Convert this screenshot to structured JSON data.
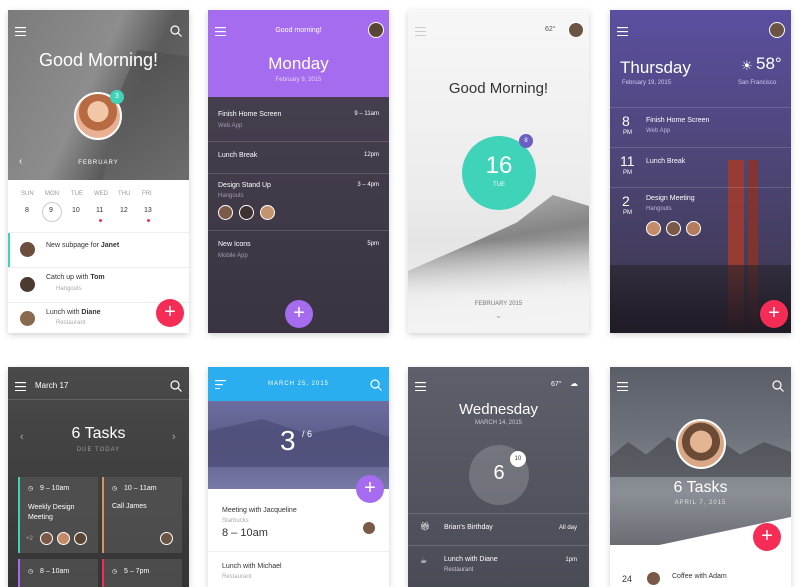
{
  "colors": {
    "accent_pink": "#f52d56",
    "accent_purple": "#a66cf0",
    "accent_teal": "#3fd3b9",
    "accent_blue": "#2aaef0"
  },
  "c1": {
    "greeting": "Good Morning!",
    "badge": "3",
    "month": "FEBRUARY",
    "days": [
      {
        "name": "SUN",
        "num": "8"
      },
      {
        "name": "MON",
        "num": "9"
      },
      {
        "name": "TUE",
        "num": "10"
      },
      {
        "name": "WED",
        "num": "11"
      },
      {
        "name": "THU",
        "num": "12"
      },
      {
        "name": "FRI",
        "num": "13"
      }
    ],
    "items": [
      {
        "prefix": "New subpage for ",
        "bold": "Janet",
        "meta": ""
      },
      {
        "prefix": "Catch up with ",
        "bold": "Tom",
        "meta": "Hangouts"
      },
      {
        "prefix": "Lunch with ",
        "bold": "Diane",
        "meta": "Restaurant"
      }
    ]
  },
  "c2": {
    "greeting": "Good morning!",
    "day": "Monday",
    "date": "February 9, 2015",
    "events": [
      {
        "title": "Finish Home Screen",
        "sub": "Web App",
        "time": "9 – 11am"
      },
      {
        "title": "Lunch Break",
        "sub": "",
        "time": "12pm"
      },
      {
        "title": "Design Stand Up",
        "sub": "Hangouts",
        "time": "3 – 4pm"
      },
      {
        "title": "New Icons",
        "sub": "Mobile App",
        "time": "5pm"
      }
    ]
  },
  "c3": {
    "temp": "62°",
    "greeting": "Good Morning!",
    "number": "16",
    "weekday": "TUE",
    "badge": "8",
    "month": "FEBRUARY 2015"
  },
  "c4": {
    "day": "Thursday",
    "date": "February 19, 2015",
    "temp": "58°",
    "city": "San Francisco",
    "events": [
      {
        "num": "8",
        "label": "PM",
        "title": "Finish Home Screen",
        "sub": "Web App"
      },
      {
        "num": "11",
        "label": "PM",
        "title": "Lunch Break",
        "sub": ""
      },
      {
        "num": "2",
        "label": "PM",
        "title": "Design Meeting",
        "sub": "Hangouts"
      }
    ]
  },
  "c5": {
    "date": "March 17",
    "tasks": "6 Tasks",
    "due": "DUE TODAY",
    "tiles": [
      {
        "time": "9 – 10am",
        "title": "Weekly Design Meeting",
        "extra": "+2"
      },
      {
        "time": "10 – 11am",
        "title": "Call James",
        "extra": ""
      },
      {
        "time": "8 – 10am",
        "title": "",
        "extra": ""
      },
      {
        "time": "5 – 7pm",
        "title": "",
        "extra": ""
      }
    ]
  },
  "c6": {
    "date": "MARCH 25, 2015",
    "progress_num": "3",
    "progress_den": "/ 6",
    "items": [
      {
        "title": "Meeting with Jacqueline",
        "sub": "Starbucks",
        "time": "8 – 10am"
      },
      {
        "title": "Lunch with Michael",
        "sub": "Restaurant",
        "time": ""
      }
    ]
  },
  "c7": {
    "temp": "67°",
    "day": "Wednesday",
    "date": "MARCH 14, 2015",
    "number": "6",
    "badge": "10",
    "items": [
      {
        "title": "Brian's Birthday",
        "sub": "",
        "right": "All day"
      },
      {
        "title": "Lunch with Diane",
        "sub": "Restaurant",
        "right": "1pm"
      }
    ]
  },
  "c8": {
    "tasks": "6 Tasks",
    "date": "APRIL 7, 2015",
    "row_num": "24",
    "row_title": "Coffee with Adam"
  }
}
